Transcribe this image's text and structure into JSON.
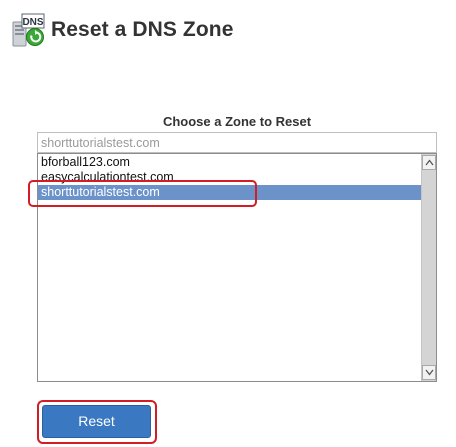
{
  "header": {
    "icon_text": "DNS",
    "icon_name": "dns-reset-icon",
    "title": "Reset a DNS Zone"
  },
  "zone_selector": {
    "label": "Choose a Zone to Reset",
    "filter_placeholder": "shorttutorialstest.com",
    "filter_value": "",
    "options": [
      {
        "label": "bforball123.com",
        "selected": false
      },
      {
        "label": "easycalculationtest.com",
        "selected": false
      },
      {
        "label": "shorttutorialstest.com",
        "selected": true
      }
    ]
  },
  "actions": {
    "reset_label": "Reset"
  },
  "colors": {
    "selection": "#6b93c9",
    "button": "#3a78c2",
    "annotation": "#d21d25",
    "title": "#333333"
  }
}
